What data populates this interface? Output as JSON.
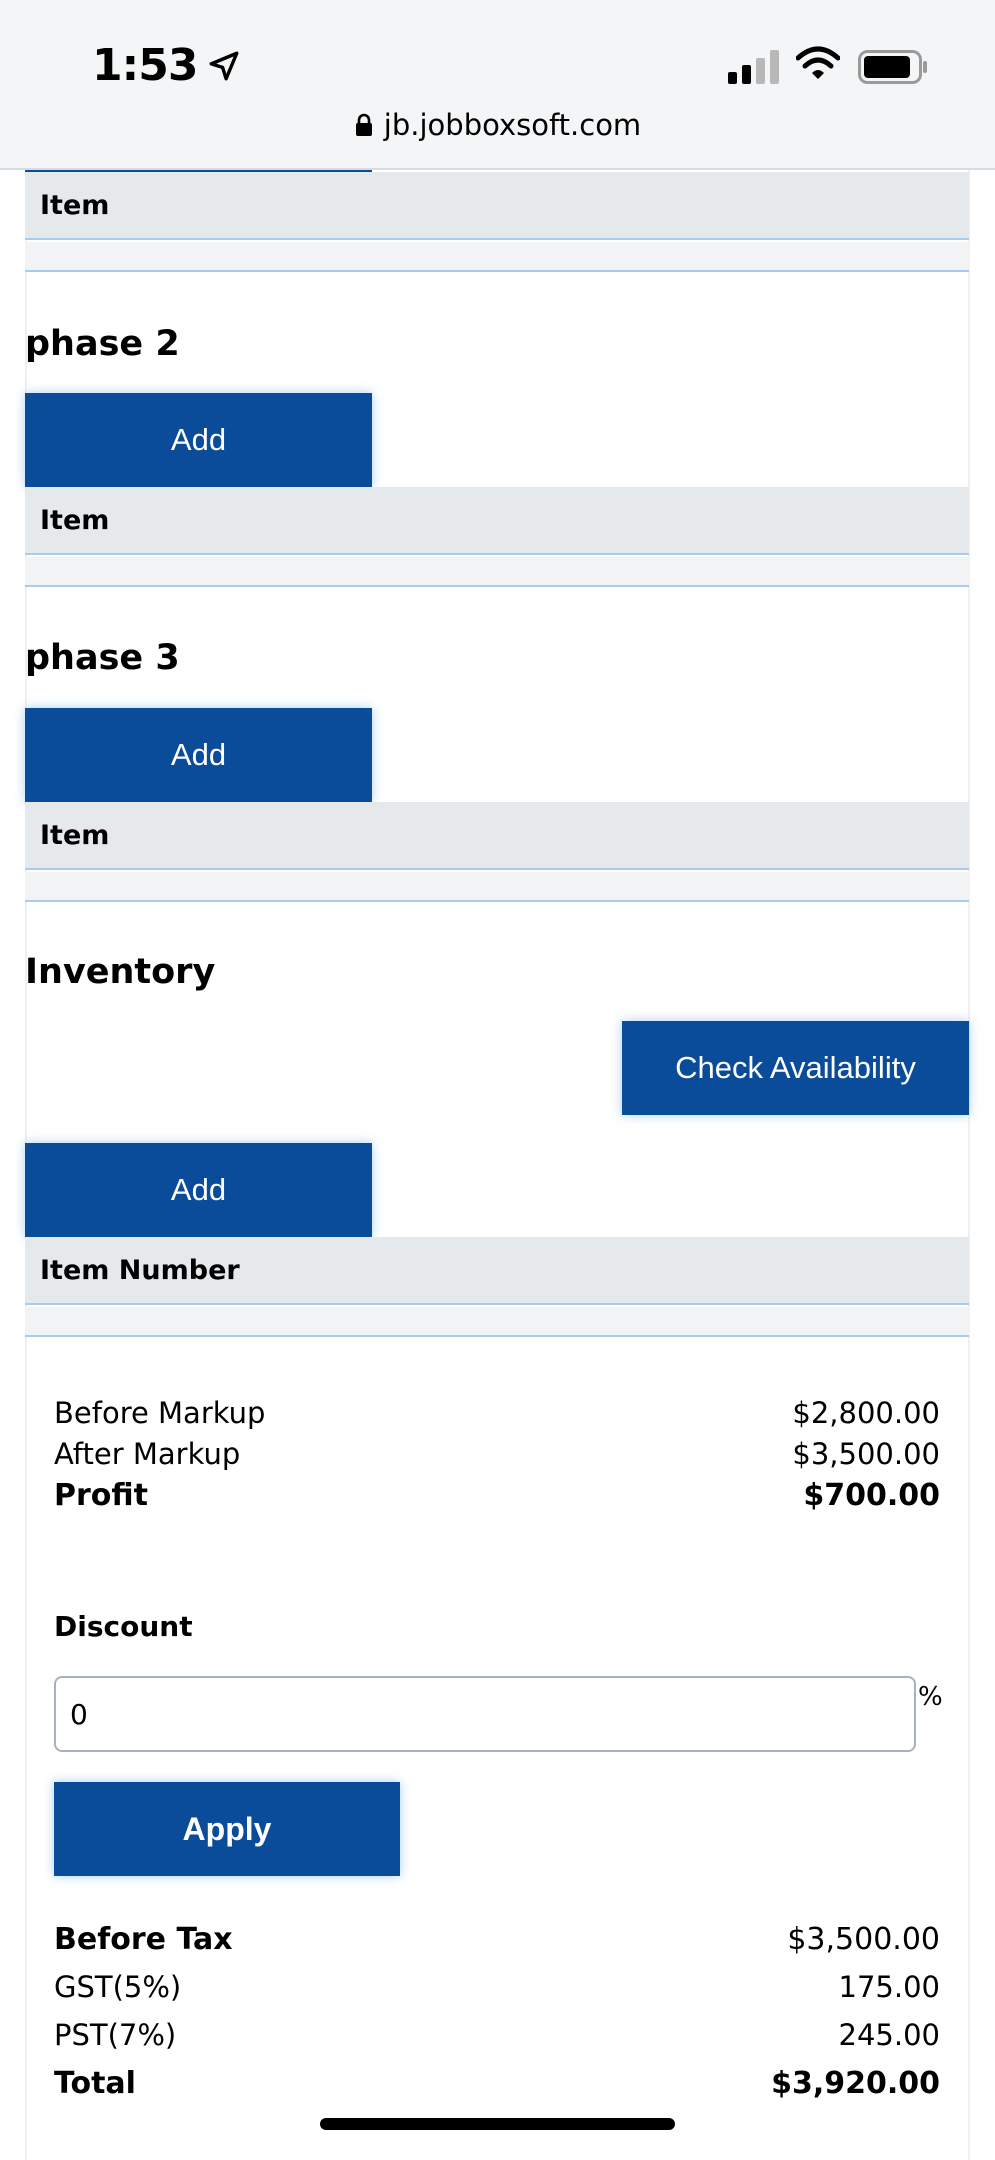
{
  "status_bar": {
    "time": "1:53",
    "url": "jb.jobboxsoft.com"
  },
  "sections": {
    "phase1": {
      "column_header": "Item"
    },
    "phase2": {
      "title": "phase 2",
      "add_label": "Add",
      "column_header": "Item"
    },
    "phase3": {
      "title": "phase 3",
      "add_label": "Add",
      "column_header": "Item"
    },
    "inventory": {
      "title": "Inventory",
      "check_label": "Check Availability",
      "add_label": "Add",
      "column_header": "Item Number"
    }
  },
  "markup_summary": {
    "before_markup_label": "Before Markup",
    "before_markup_value": "$2,800.00",
    "after_markup_label": "After Markup",
    "after_markup_value": "$3,500.00",
    "profit_label": "Profit",
    "profit_value": "$700.00"
  },
  "discount": {
    "label": "Discount",
    "value": "0",
    "unit": "%",
    "apply_label": "Apply"
  },
  "totals": {
    "before_tax_label": "Before Tax",
    "before_tax_value": "$3,500.00",
    "gst_label": "GST(5%)",
    "gst_value": "175.00",
    "pst_label": "PST(7%)",
    "pst_value": "245.00",
    "total_label": "Total",
    "total_value": "$3,920.00"
  },
  "colors": {
    "primary": "#0a4c9a",
    "header_bg": "#e6e9ec",
    "rule": "#a9cbef"
  }
}
